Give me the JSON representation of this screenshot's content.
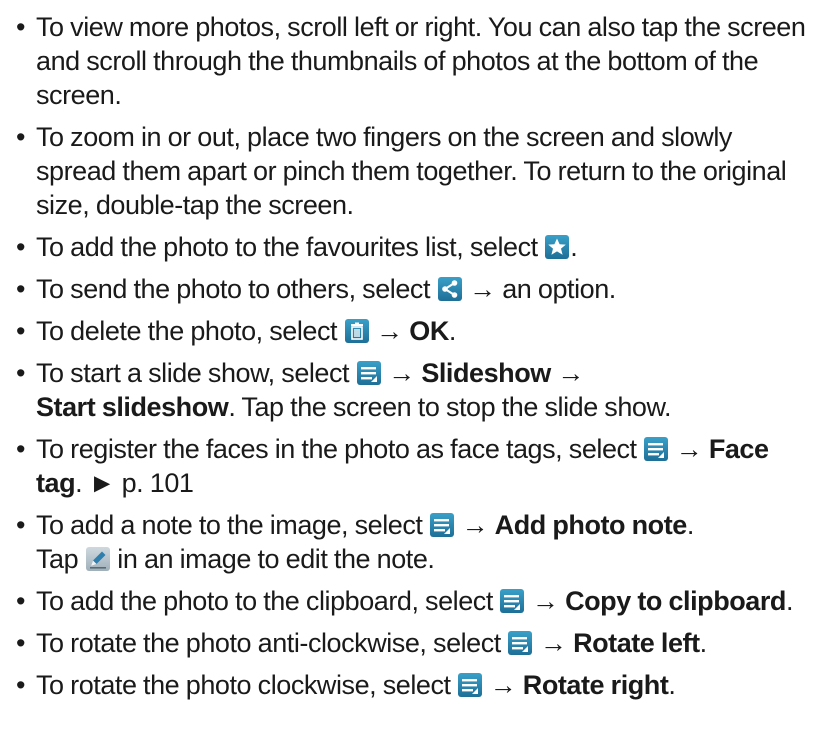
{
  "colors": {
    "text": "#1a1a1a",
    "icon_blue": "#2a86b0",
    "icon_pen": "#b7c4cc"
  },
  "icons": {
    "favourite": "star-icon",
    "share": "share-icon",
    "delete": "trash-icon",
    "menu": "menu-icon",
    "edit": "pen-icon"
  },
  "bullet_char": "•",
  "items": [
    {
      "segments": [
        {
          "t": "text",
          "v": "To view more photos, scroll left or right. You can also tap the screen and scroll through the thumbnails of photos at the bottom of the screen."
        }
      ]
    },
    {
      "segments": [
        {
          "t": "text",
          "v": "To zoom in or out, place two fingers on the screen and slowly spread them apart or pinch them together. To return to the original size, double-tap the screen."
        }
      ]
    },
    {
      "segments": [
        {
          "t": "text",
          "v": "To add the photo to the favourites list, select "
        },
        {
          "t": "icon",
          "v": "star"
        },
        {
          "t": "text",
          "v": "."
        }
      ]
    },
    {
      "segments": [
        {
          "t": "text",
          "v": "To send the photo to others, select "
        },
        {
          "t": "icon",
          "v": "share"
        },
        {
          "t": "text",
          "v": " → an option."
        }
      ]
    },
    {
      "segments": [
        {
          "t": "text",
          "v": "To delete the photo, select "
        },
        {
          "t": "icon",
          "v": "trash"
        },
        {
          "t": "text",
          "v": " → "
        },
        {
          "t": "bold",
          "v": "OK"
        },
        {
          "t": "text",
          "v": "."
        }
      ]
    },
    {
      "segments": [
        {
          "t": "text",
          "v": "To start a slide show, select "
        },
        {
          "t": "icon",
          "v": "menu"
        },
        {
          "t": "text",
          "v": " → "
        },
        {
          "t": "bold",
          "v": "Slideshow"
        },
        {
          "t": "text",
          "v": " → "
        },
        {
          "t": "br",
          "v": ""
        },
        {
          "t": "bold",
          "v": "Start slideshow"
        },
        {
          "t": "text",
          "v": ". Tap the screen to stop the slide show."
        }
      ]
    },
    {
      "segments": [
        {
          "t": "text",
          "v": "To register the faces in the photo as face tags, select "
        },
        {
          "t": "icon",
          "v": "menu"
        },
        {
          "t": "text",
          "v": " → "
        },
        {
          "t": "bold",
          "v": "Face tag"
        },
        {
          "t": "text",
          "v": ". ► p. 101"
        }
      ]
    },
    {
      "segments": [
        {
          "t": "text",
          "v": "To add a note to the image, select "
        },
        {
          "t": "icon",
          "v": "menu"
        },
        {
          "t": "text",
          "v": " → "
        },
        {
          "t": "bold",
          "v": "Add photo note"
        },
        {
          "t": "text",
          "v": ". "
        },
        {
          "t": "br",
          "v": ""
        },
        {
          "t": "text",
          "v": "Tap "
        },
        {
          "t": "icon",
          "v": "pen"
        },
        {
          "t": "text",
          "v": " in an image to edit the note."
        }
      ]
    },
    {
      "segments": [
        {
          "t": "text",
          "v": "To add the photo to the clipboard, select "
        },
        {
          "t": "icon",
          "v": "menu"
        },
        {
          "t": "text",
          "v": " → "
        },
        {
          "t": "bold",
          "v": "Copy to clipboard"
        },
        {
          "t": "text",
          "v": "."
        }
      ]
    },
    {
      "segments": [
        {
          "t": "text",
          "v": "To rotate the photo anti-clockwise, select "
        },
        {
          "t": "icon",
          "v": "menu"
        },
        {
          "t": "text",
          "v": " → "
        },
        {
          "t": "bold",
          "v": "Rotate left"
        },
        {
          "t": "text",
          "v": "."
        }
      ]
    },
    {
      "segments": [
        {
          "t": "text",
          "v": "To rotate the photo clockwise, select "
        },
        {
          "t": "icon",
          "v": "menu"
        },
        {
          "t": "text",
          "v": " → "
        },
        {
          "t": "bold",
          "v": "Rotate right"
        },
        {
          "t": "text",
          "v": "."
        }
      ]
    }
  ]
}
